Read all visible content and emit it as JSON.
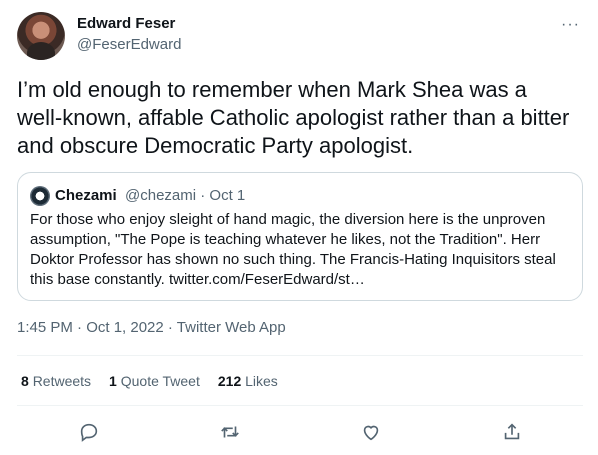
{
  "tweet": {
    "author_name": "Edward Feser",
    "author_handle": "@FeserEdward",
    "more_icon": "more-horizontal-icon",
    "text": "I’m old enough to remember when Mark Shea was a well-known, affable Catholic apologist rather than a bitter and obscure Democratic Party apologist.",
    "timestamp": "1:45 PM · Oct 1, 2022 · Twitter Web App"
  },
  "quote": {
    "author_name": "Chezami",
    "meta": "@chezami · Oct 1",
    "text": "For those who enjoy sleight of hand magic, the diversion here is the unproven assumption, \"The Pope is teaching whatever he likes, not the Tradition\". Herr Doktor Professor has shown no such thing. The Francis-Hating Inquisitors steal this base constantly. twitter.com/FeserEdward/st…"
  },
  "stats": [
    {
      "count": "8",
      "label": "Retweets"
    },
    {
      "count": "1",
      "label": "Quote Tweet"
    },
    {
      "count": "212",
      "label": "Likes"
    }
  ],
  "actions": [
    {
      "icon": "reply-icon"
    },
    {
      "icon": "retweet-icon"
    },
    {
      "icon": "like-icon"
    },
    {
      "icon": "share-icon"
    }
  ]
}
